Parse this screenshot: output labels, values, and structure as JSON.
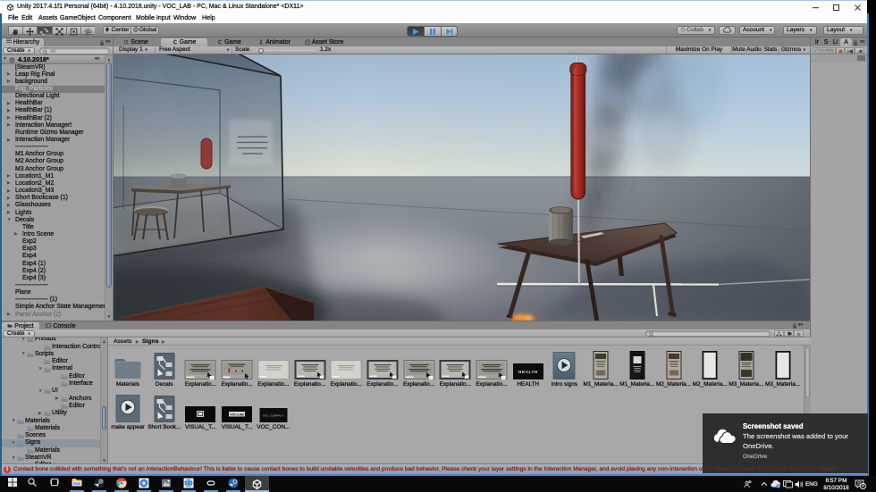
{
  "window": {
    "title": "Unity 2017.4.1f1 Personal (64bit) - 4.10.2018.unity - VOC_LAB - PC, Mac & Linux Standalone* <DX11>",
    "menus": [
      "File",
      "Edit",
      "Assets",
      "GameObject",
      "Component",
      "Mobile Input",
      "Window",
      "Help"
    ]
  },
  "toolbar": {
    "center_label": "Center",
    "global_label": "Global",
    "collab_label": "Collab",
    "account_label": "Account",
    "layers_label": "Layers",
    "layout_label": "Layout"
  },
  "hierarchy": {
    "tab": "Hierarchy",
    "create_label": "Create",
    "search_hint": "All",
    "scene_name": "4.10.2018*",
    "items": [
      {
        "label": "[SteamVR]",
        "arrow": ""
      },
      {
        "label": "Leap Rig Final",
        "arrow": "r"
      },
      {
        "label": "background",
        "arrow": "r"
      },
      {
        "label": "Fog_Particles",
        "arrow": "",
        "selected": true,
        "disabled": true
      },
      {
        "label": "Directional Light",
        "arrow": ""
      },
      {
        "label": "HealthBar",
        "arrow": "r"
      },
      {
        "label": "HealthBar (1)",
        "arrow": "r"
      },
      {
        "label": "HealthBar (2)",
        "arrow": "r"
      },
      {
        "label": "Interaction Manager!",
        "arrow": "r"
      },
      {
        "label": "Runtime Gizmo Manager",
        "arrow": ""
      },
      {
        "label": "Interaction Manager",
        "arrow": "r"
      },
      {
        "label": "----------------",
        "arrow": ""
      },
      {
        "label": "M1 Anchor Group",
        "arrow": ""
      },
      {
        "label": "M2 Anchor Group",
        "arrow": ""
      },
      {
        "label": "M3 Anchor Group",
        "arrow": ""
      },
      {
        "label": "Location1_M1",
        "arrow": "r"
      },
      {
        "label": "Location2_M2",
        "arrow": "r"
      },
      {
        "label": "Location3_M3",
        "arrow": "r"
      },
      {
        "label": "Short Bookcase (1)",
        "arrow": "r"
      },
      {
        "label": "Glasshouses",
        "arrow": "r"
      },
      {
        "label": "Lights",
        "arrow": "r"
      },
      {
        "label": "Decals",
        "arrow": "d"
      },
      {
        "label": "Title",
        "arrow": "",
        "indent": 1
      },
      {
        "label": "Intro Scene",
        "arrow": "r",
        "indent": 1
      },
      {
        "label": "Exp2",
        "arrow": "",
        "indent": 1
      },
      {
        "label": "Exp3",
        "arrow": "",
        "indent": 1
      },
      {
        "label": "Exp4",
        "arrow": "",
        "indent": 1
      },
      {
        "label": "Exp4 (1)",
        "arrow": "",
        "indent": 1
      },
      {
        "label": "Exp4 (2)",
        "arrow": "",
        "indent": 1
      },
      {
        "label": "Exp4 (3)",
        "arrow": "",
        "indent": 1
      },
      {
        "label": "----------------",
        "arrow": ""
      },
      {
        "label": "Plane",
        "arrow": ""
      },
      {
        "label": "---------------- (1)",
        "arrow": ""
      },
      {
        "label": "Simple Anchor State Management",
        "arrow": ""
      },
      {
        "label": "Panel Anchor (2)",
        "arrow": "r",
        "disabled": true
      }
    ]
  },
  "game": {
    "tabs": [
      {
        "label": "Scene",
        "icon": "scene"
      },
      {
        "label": "Game",
        "icon": "game",
        "active": true
      },
      {
        "label": "Game",
        "icon": "game"
      },
      {
        "label": "Animator",
        "icon": "animator"
      },
      {
        "label": "Asset Store",
        "icon": "store"
      }
    ],
    "display_label": "Display 1",
    "aspect_label": "Free Aspect",
    "scale_label": "Scale",
    "scale_value": "1.2x",
    "right_buttons": [
      "Maximize On Play",
      "Mute Audio",
      "Stats",
      "Gizmos"
    ]
  },
  "rightpanel": {
    "tabs": [
      "Ir",
      "S",
      "Li",
      "A"
    ],
    "preview_label": "Preview"
  },
  "project": {
    "tabs": [
      "Project",
      "Console"
    ],
    "create_label": "Create",
    "breadcrumb": [
      "Assets",
      "Signs"
    ],
    "tree": [
      {
        "label": "Prefabs",
        "arrow": "d",
        "level": 1
      },
      {
        "label": "Interaction Control",
        "arrow": "",
        "level": 2
      },
      {
        "label": "Scripts",
        "arrow": "d",
        "level": 1
      },
      {
        "label": "Editor",
        "arrow": "",
        "level": 2
      },
      {
        "label": "Internal",
        "arrow": "d",
        "level": 2
      },
      {
        "label": "Editor",
        "arrow": "",
        "level": 3
      },
      {
        "label": "Interface",
        "arrow": "",
        "level": 3
      },
      {
        "label": "UI",
        "arrow": "d",
        "level": 2
      },
      {
        "label": "Anchors",
        "arrow": "r",
        "level": 3
      },
      {
        "label": "Editor",
        "arrow": "",
        "level": 3
      },
      {
        "label": "Utility",
        "arrow": "r",
        "level": 2
      },
      {
        "label": "Materials",
        "arrow": "d",
        "level": 0
      },
      {
        "label": "Materials",
        "arrow": "",
        "level": 1
      },
      {
        "label": "Scenes",
        "arrow": "",
        "level": 0
      },
      {
        "label": "Signs",
        "arrow": "d",
        "level": 0,
        "selected": true
      },
      {
        "label": "Materials",
        "arrow": "",
        "level": 1
      },
      {
        "label": "SteamVR",
        "arrow": "d",
        "level": 0
      },
      {
        "label": "Editor",
        "arrow": "",
        "level": 1
      }
    ],
    "grid_row1": [
      {
        "label": "Materials",
        "kind": "folder"
      },
      {
        "label": "Decals",
        "kind": "prefab"
      },
      {
        "label": "Explanatio...",
        "kind": "sign"
      },
      {
        "label": "Explanatio...",
        "kind": "sign-red"
      },
      {
        "label": "Explanatio...",
        "kind": "sign-light"
      },
      {
        "label": "Explanatio...",
        "kind": "sign-frame"
      },
      {
        "label": "Explanatio...",
        "kind": "sign-light"
      },
      {
        "label": "Explanatio...",
        "kind": "sign-frame"
      },
      {
        "label": "Explanatio...",
        "kind": "sign"
      },
      {
        "label": "Explanatio...",
        "kind": "sign-frame"
      },
      {
        "label": "Explanatio...",
        "kind": "sign"
      },
      {
        "label": "HEALTH",
        "kind": "black-health",
        "text": "HEALTH"
      },
      {
        "label": "intro signs",
        "kind": "video"
      },
      {
        "label": "M1_Materia...",
        "kind": "poster-grunge"
      },
      {
        "label": "M1_Materia...",
        "kind": "poster-dark"
      },
      {
        "label": "M2_Materia...",
        "kind": "poster-grunge"
      },
      {
        "label": "M2_Materia...",
        "kind": "poster-white"
      },
      {
        "label": "M3_Materia...",
        "kind": "poster-grunge2"
      },
      {
        "label": "M3_Materia...",
        "kind": "poster-white"
      }
    ],
    "grid_row2": [
      {
        "label": "make appear",
        "kind": "video2"
      },
      {
        "label": "Short Book...",
        "kind": "prefab"
      },
      {
        "label": "VISUAL_T...",
        "kind": "black-speck"
      },
      {
        "label": "VISUAL_T...",
        "kind": "black-voclab"
      },
      {
        "label": "VOC_CON...",
        "kind": "black-voccom"
      }
    ]
  },
  "statusbar": {
    "error_text": "Contact bone collided with something that's not an InteractionBehaviour! This is liable to cause contact bones to build unstable velocities and produce bad behavior. Please check your layer settings in the Interaction Manager, and avoid placing any non-Interaction objects in layers that contain interaction objects."
  },
  "toast": {
    "title": "Screenshot saved",
    "line1": "The screenshot was added to your",
    "line2": "OneDrive.",
    "app": "OneDrive",
    "seethrough": "on objects in layers that contain interaction objects."
  },
  "taskbar": {
    "lang": "ENG",
    "time": "6:57 PM",
    "date": "8/10/2018",
    "badge": "2"
  },
  "colors": {
    "accent_blue": "#4b87c3",
    "error_red": "#8c1d1d",
    "tube_red": "#b23229",
    "selection_gray": "#7b7b7b"
  }
}
